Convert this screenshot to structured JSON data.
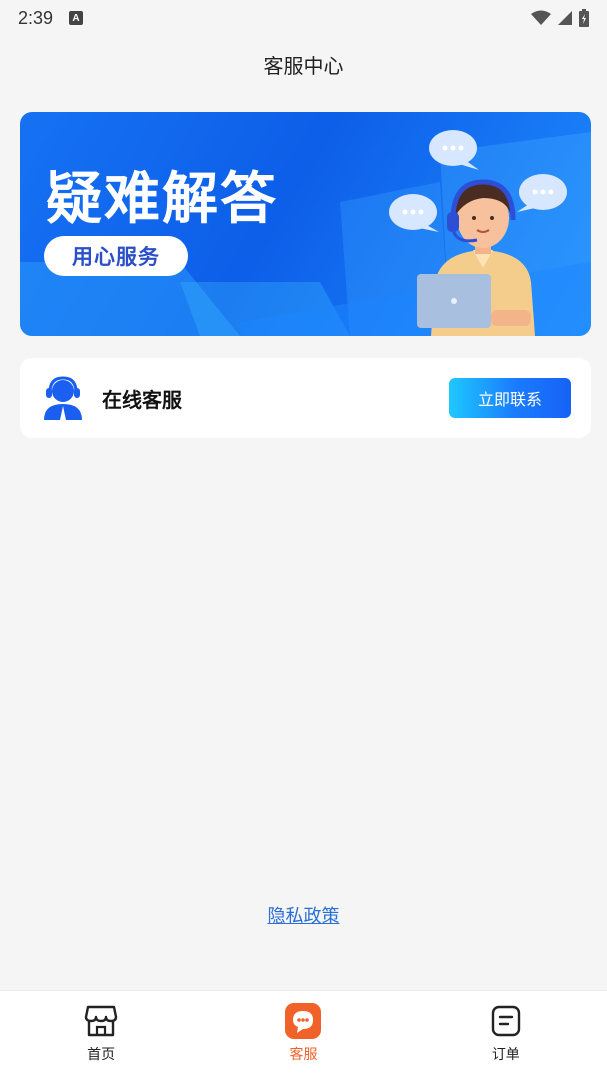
{
  "status_bar": {
    "time": "2:39",
    "badge": "A"
  },
  "header": {
    "title": "客服中心"
  },
  "banner": {
    "title": "疑难解答",
    "subtitle": "用心服务"
  },
  "contact": {
    "label": "在线客服",
    "button_label": "立即联系"
  },
  "privacy_link": "隐私政策",
  "bottom_nav": {
    "items": [
      {
        "label": "首页",
        "icon": "shop-icon"
      },
      {
        "label": "客服",
        "icon": "chat-bubble-icon",
        "active": true
      },
      {
        "label": "订单",
        "icon": "order-list-icon"
      }
    ]
  },
  "colors": {
    "accent": "#f0622a",
    "banner_blue": "#1672f3",
    "button_gradient_start": "#1ec8ff",
    "button_gradient_end": "#1662f5",
    "link": "#2a6fd6"
  }
}
